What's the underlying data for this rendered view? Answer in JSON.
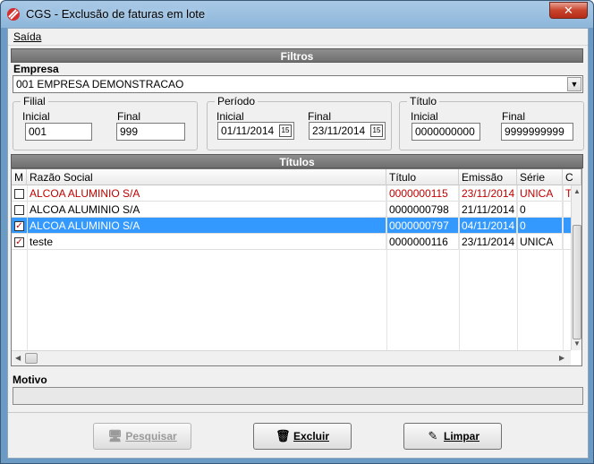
{
  "window": {
    "title": "CGS - Exclusão de faturas em lote",
    "close_label": "✕"
  },
  "menu": {
    "saida": "Saída"
  },
  "filtros": {
    "header": "Filtros",
    "empresa_label": "Empresa",
    "empresa_value": "001 EMPRESA DEMONSTRACAO",
    "filial": {
      "title": "Filial",
      "inicial_label": "Inicial",
      "final_label": "Final",
      "inicial": "001",
      "final": "999"
    },
    "periodo": {
      "title": "Período",
      "inicial_label": "Inicial",
      "final_label": "Final",
      "inicial": "01/11/2014",
      "final": "23/11/2014",
      "calendar_label": "15"
    },
    "titulo": {
      "title": "Título",
      "inicial_label": "Inicial",
      "final_label": "Final",
      "inicial": "0000000000",
      "final": "9999999999"
    }
  },
  "titulos": {
    "header": "Títulos",
    "columns": [
      "M",
      "Razão Social",
      "Título",
      "Emissão",
      "Série",
      "C"
    ],
    "rows": [
      {
        "checked": false,
        "razao": "ALCOA ALUMINIO S/A",
        "titulo": "0000000115",
        "emissao": "23/11/2014",
        "serie": "UNICA",
        "c": "T",
        "style": "highlight"
      },
      {
        "checked": false,
        "razao": "ALCOA ALUMINIO S/A",
        "titulo": "0000000798",
        "emissao": "21/11/2014",
        "serie": "0",
        "c": "",
        "style": "normal"
      },
      {
        "checked": true,
        "razao": "ALCOA ALUMINIO S/A",
        "titulo": "0000000797",
        "emissao": "04/11/2014",
        "serie": "0",
        "c": "",
        "style": "selected"
      },
      {
        "checked": true,
        "razao": "teste",
        "titulo": "0000000116",
        "emissao": "23/11/2014",
        "serie": "UNICA",
        "c": "",
        "style": "normal"
      }
    ]
  },
  "motivo": {
    "label": "Motivo",
    "value": ""
  },
  "buttons": {
    "pesquisar": "Pesquisar",
    "excluir": "Excluir",
    "limpar": "Limpar"
  },
  "colors": {
    "selected_row": "#3399ff",
    "highlight_text": "#c00000",
    "section_header": "#7a7a7a"
  }
}
